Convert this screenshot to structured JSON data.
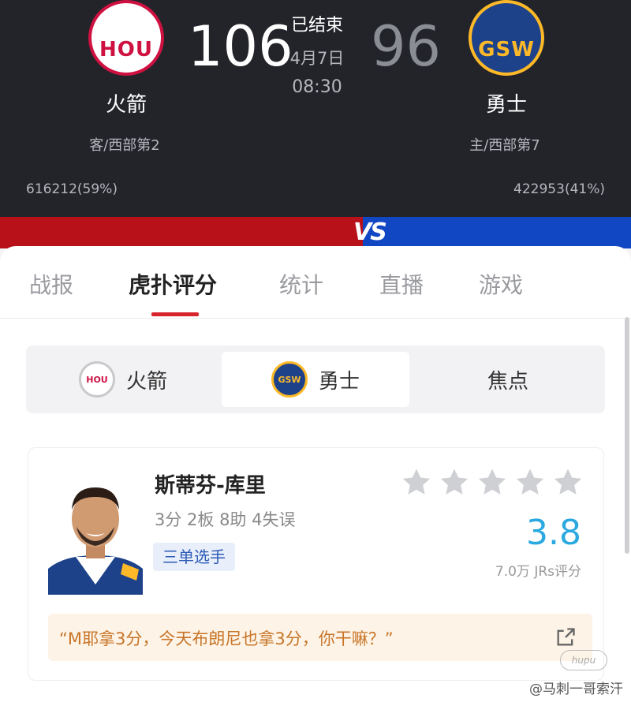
{
  "game": {
    "home_team": {
      "name": "火箭",
      "logo_text": "HOU",
      "score": "106",
      "rank": "客/西部第2",
      "votes": "616212(59%)"
    },
    "away_team": {
      "name": "勇士",
      "logo_text": "GSW",
      "score": "96",
      "rank": "主/西部第7",
      "votes": "422953(41%)"
    },
    "status": "已结束",
    "date": "4月7日",
    "time": "08:30",
    "vs_label": "VS"
  },
  "colors": {
    "hou_red": "#b8111a",
    "gsw_blue": "#1247c4",
    "rating_blue": "#2aa9e0",
    "tab_accent": "#d8242c"
  },
  "tabs": [
    {
      "label": "战报",
      "active": false
    },
    {
      "label": "虎扑评分",
      "active": true
    },
    {
      "label": "统计",
      "active": false
    },
    {
      "label": "直播",
      "active": false
    },
    {
      "label": "游戏",
      "active": false
    }
  ],
  "team_switch": {
    "hou": {
      "label": "火箭",
      "logo_text": "HOU"
    },
    "gsw": {
      "label": "勇士",
      "logo_text": "GSW",
      "selected": true
    },
    "focus": {
      "label": "焦点"
    }
  },
  "player": {
    "name": "斯蒂芬-库里",
    "stats": "3分 2板 8助 4失误",
    "tag": "三单选手",
    "rating": "3.8",
    "rating_count": "7.0万 JRs评分",
    "stars_filled": 0,
    "stars_total": 5,
    "comment": "“M耶拿3分，今天布朗尼也拿3分，你干嘛？”"
  },
  "watermark": {
    "text": "@马刺一哥索汗",
    "logo_text": "hupu"
  },
  "icons": {
    "star": "star-icon",
    "share": "share-icon"
  }
}
